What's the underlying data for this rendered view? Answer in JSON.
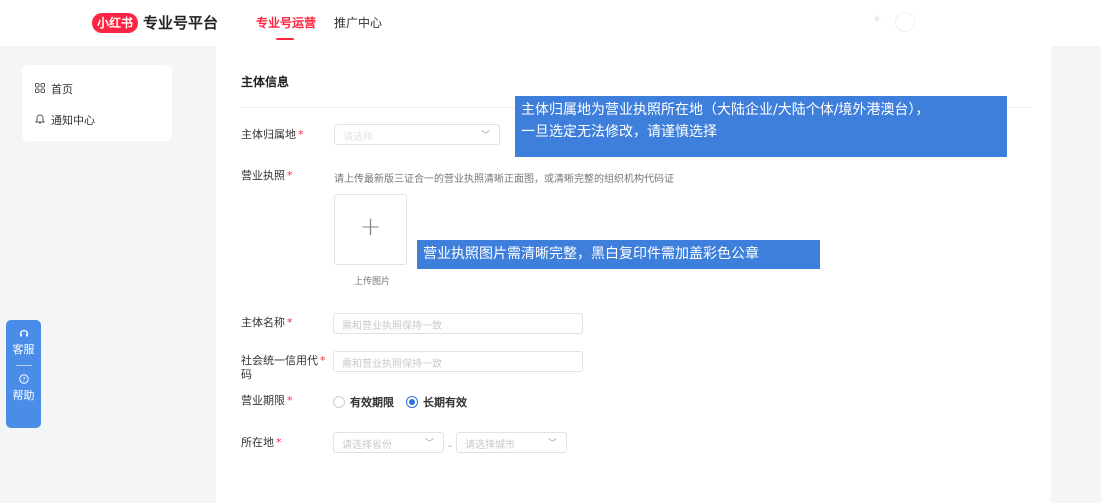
{
  "header": {
    "logo_text": "小红书",
    "brand_title": "专业号平台",
    "tabs": [
      {
        "label": "专业号运营",
        "active": true
      },
      {
        "label": "推广中心",
        "active": false
      }
    ],
    "accent_color": "#ff2442"
  },
  "sidebar": {
    "items": [
      {
        "label": "首页",
        "icon": "grid-icon"
      },
      {
        "label": "通知中心",
        "icon": "bell-icon"
      }
    ]
  },
  "float_service": {
    "items": [
      {
        "label": "客服",
        "icon": "headset-icon"
      },
      {
        "label": "帮助",
        "icon": "help-circle-icon"
      }
    ],
    "color": "#4a8ce8"
  },
  "form": {
    "section_title": "主体信息",
    "required_mark": "*",
    "entity_location": {
      "label": "主体归属地",
      "value": "",
      "placeholder": "请选择"
    },
    "business_license": {
      "label": "营业执照",
      "hint": "请上传最新版三证合一的营业执照清晰正面图，或清晰完整的组织机构代码证",
      "upload_label": "上传图片"
    },
    "entity_name": {
      "label": "主体名称",
      "placeholder": "需和营业执照保持一致"
    },
    "credit_code": {
      "label_line1": "社会统一信用代",
      "label_line2": "码",
      "placeholder": "需和营业执照保持一致"
    },
    "business_term": {
      "label": "营业期限",
      "options": [
        {
          "label": "有效期限",
          "selected": false
        },
        {
          "label": "长期有效",
          "selected": true
        }
      ]
    },
    "location": {
      "label": "所在地",
      "province_placeholder": "请选择省份",
      "city_placeholder": "请选择城市",
      "separator": "-"
    }
  },
  "annotations": {
    "location_note_line1": "主体归属地为营业执照所在地（大陆企业/大陆个体/境外港澳台），",
    "location_note_line2": "一旦选定无法修改，请谨慎选择",
    "license_note": "营业执照图片需清晰完整，黑白复印件需加盖彩色公章",
    "color": "#3f7fdc"
  }
}
